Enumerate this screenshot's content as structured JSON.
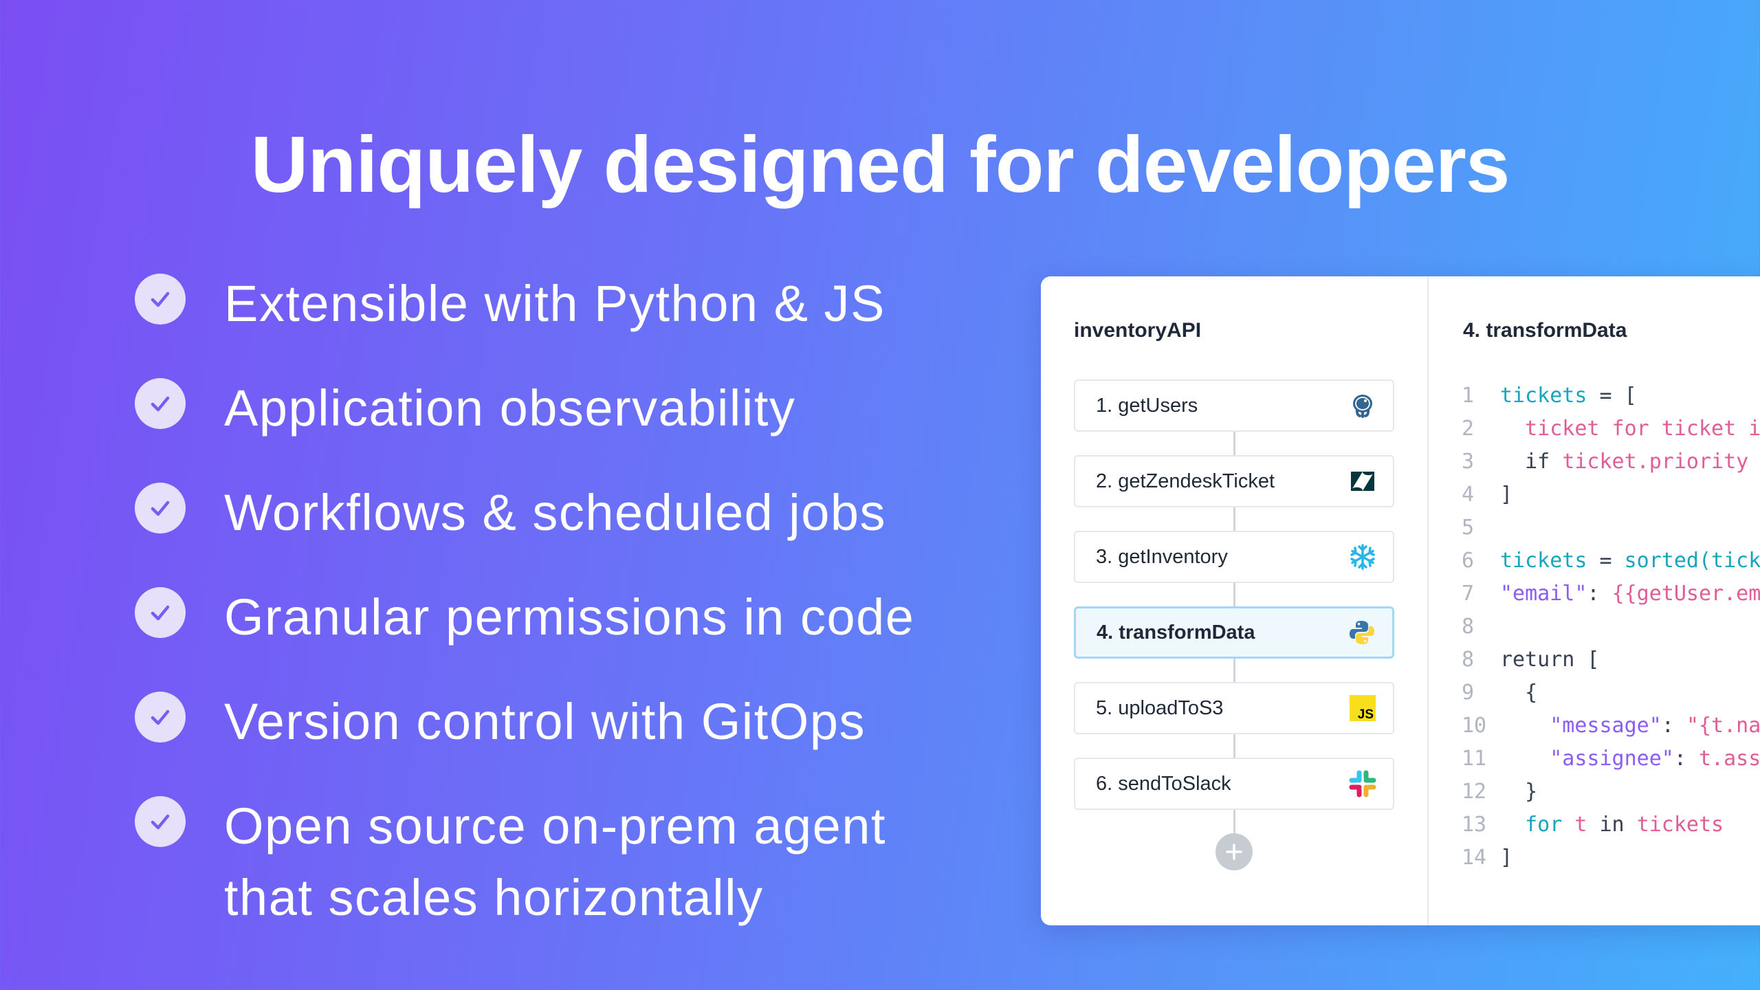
{
  "headline": "Uniquely designed for developers",
  "features": [
    {
      "lines": [
        "Extensible with Python & JS"
      ]
    },
    {
      "lines": [
        "Application observability"
      ]
    },
    {
      "lines": [
        "Workflows & scheduled jobs"
      ]
    },
    {
      "lines": [
        "Granular permissions in code"
      ]
    },
    {
      "lines": [
        "Version control with GitOps"
      ]
    },
    {
      "lines": [
        "Open source on-prem agent",
        "that scales horizontally"
      ]
    }
  ],
  "workflow": {
    "title": "inventoryAPI",
    "steps": [
      {
        "label": "1. getUsers",
        "icon": "postgres-icon",
        "active": false
      },
      {
        "label": "2. getZendeskTicket",
        "icon": "zendesk-icon",
        "active": false
      },
      {
        "label": "3. getInventory",
        "icon": "snowflake-icon",
        "active": false
      },
      {
        "label": "4. transformData",
        "icon": "python-icon",
        "active": true
      },
      {
        "label": "5. uploadToS3",
        "icon": "javascript-icon",
        "active": false
      },
      {
        "label": "6. sendToSlack",
        "icon": "slack-icon",
        "active": false
      }
    ],
    "add_button_icon": "plus-icon"
  },
  "editor": {
    "title": "4. transformData",
    "lines": [
      {
        "num": "1",
        "tokens": [
          {
            "t": "tickets",
            "c": "teal"
          },
          {
            "t": " = [",
            "c": "dark"
          }
        ]
      },
      {
        "num": "2",
        "tokens": [
          {
            "t": "  ",
            "c": "dark"
          },
          {
            "t": "ticket for ticket in",
            "c": "pink"
          }
        ]
      },
      {
        "num": "3",
        "tokens": [
          {
            "t": "  if ",
            "c": "dark"
          },
          {
            "t": "ticket.priority",
            "c": "pink"
          }
        ]
      },
      {
        "num": "4",
        "tokens": [
          {
            "t": "]",
            "c": "dark"
          }
        ]
      },
      {
        "num": "5",
        "tokens": []
      },
      {
        "num": "6",
        "tokens": [
          {
            "t": "tickets",
            "c": "teal"
          },
          {
            "t": " = ",
            "c": "dark"
          },
          {
            "t": "sorted(tick",
            "c": "teal"
          }
        ]
      },
      {
        "num": "7",
        "tokens": [
          {
            "t": "\"email\"",
            "c": "purple"
          },
          {
            "t": ": ",
            "c": "dark"
          },
          {
            "t": "{{getUser.em",
            "c": "pink"
          }
        ]
      },
      {
        "num": "8",
        "tokens": []
      },
      {
        "num": "8",
        "tokens": [
          {
            "t": "return [",
            "c": "dark"
          }
        ]
      },
      {
        "num": "9",
        "tokens": [
          {
            "t": "  {",
            "c": "dark"
          }
        ]
      },
      {
        "num": "10",
        "tokens": [
          {
            "t": "    ",
            "c": "dark"
          },
          {
            "t": "\"message\"",
            "c": "purple"
          },
          {
            "t": ": ",
            "c": "dark"
          },
          {
            "t": "\"{t.na",
            "c": "pink"
          }
        ]
      },
      {
        "num": "11",
        "tokens": [
          {
            "t": "    ",
            "c": "dark"
          },
          {
            "t": "\"assignee\"",
            "c": "purple"
          },
          {
            "t": ": ",
            "c": "dark"
          },
          {
            "t": "t.ass",
            "c": "pink"
          }
        ]
      },
      {
        "num": "12",
        "tokens": [
          {
            "t": "  }",
            "c": "dark"
          }
        ]
      },
      {
        "num": "13",
        "tokens": [
          {
            "t": "  for ",
            "c": "teal"
          },
          {
            "t": "t",
            "c": "pink"
          },
          {
            "t": " in ",
            "c": "dark"
          },
          {
            "t": "tickets",
            "c": "pink"
          }
        ]
      },
      {
        "num": "14",
        "tokens": [
          {
            "t": "]",
            "c": "dark"
          }
        ]
      }
    ]
  },
  "colors": {
    "gradient_start": "#7b4ef4",
    "gradient_end": "#43b0fb",
    "check_bg": "#e6e0fb",
    "check_mark": "#7c5cf0",
    "active_step_bg": "#eef8fd",
    "active_step_border": "#9fd9f3",
    "code_teal": "#16a5bd",
    "code_pink": "#e05d96",
    "code_purple": "#8b5cf6"
  }
}
